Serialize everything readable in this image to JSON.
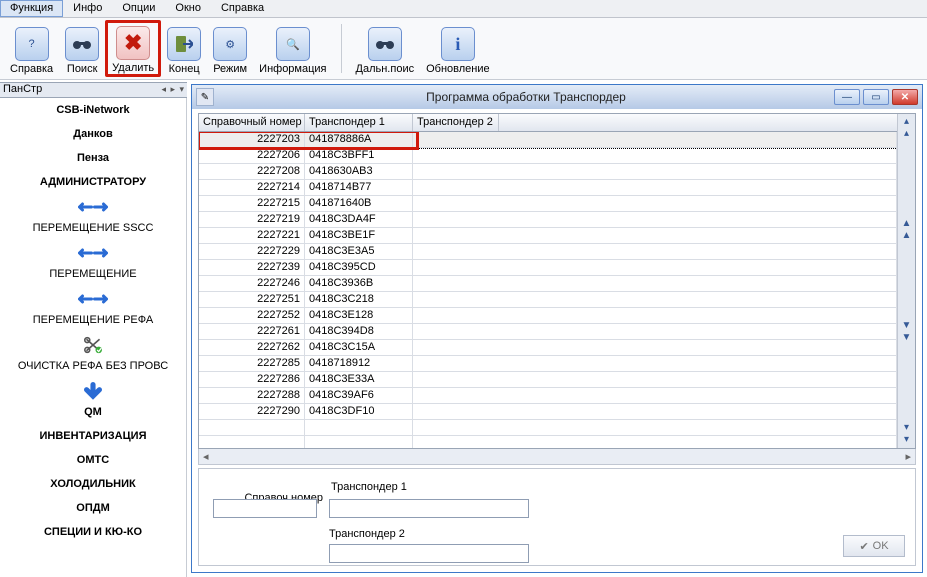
{
  "menu": {
    "items": [
      "Функция",
      "Инфо",
      "Опции",
      "Окно",
      "Справка"
    ],
    "active_index": 0
  },
  "toolbar": [
    {
      "label": "Справка",
      "icon": "?"
    },
    {
      "label": "Поиск",
      "icon": "bino"
    },
    {
      "label": "Удалить",
      "icon": "✖",
      "highlighted": true
    },
    {
      "label": "Конец",
      "icon": "exit"
    },
    {
      "label": "Режим",
      "icon": "⚙"
    },
    {
      "label": "Информация",
      "icon": "🔍"
    },
    {
      "sep": true
    },
    {
      "label": "Дальн.поис",
      "icon": "bino"
    },
    {
      "label": "Обновление",
      "icon": "i"
    }
  ],
  "sidehead": {
    "title": "ПанСтр"
  },
  "sidebar": [
    {
      "label": "CSB-iNetwork",
      "bold": true
    },
    {
      "label": "Данков",
      "bold": true
    },
    {
      "label": "Пенза",
      "bold": true
    },
    {
      "label": "АДМИНИСТРАТОРУ",
      "bold": true
    },
    {
      "icon": "hswap"
    },
    {
      "label": "ПЕРЕМЕЩЕНИЕ SSCC"
    },
    {
      "icon": "hswap"
    },
    {
      "label": "ПЕРЕМЕЩЕНИЕ"
    },
    {
      "icon": "hswap"
    },
    {
      "label": "ПЕРЕМЕЩЕНИЕ РЕФА"
    },
    {
      "icon": "scissor"
    },
    {
      "label": "ОЧИСТКА РЕФА БЕЗ ПРОВС"
    },
    {
      "icon": "down"
    },
    {
      "label": "QM",
      "bold": true
    },
    {
      "label": "ИНВЕНТАРИЗАЦИЯ",
      "bold": true
    },
    {
      "label": "ОМТС",
      "bold": true
    },
    {
      "label": "ХОЛОДИЛЬНИК",
      "bold": true
    },
    {
      "label": "ОПДМ",
      "bold": true
    },
    {
      "label": "СПЕЦИИ И КЮ-КО",
      "bold": true
    }
  ],
  "window": {
    "title": "Программа обработки Транспордер"
  },
  "grid": {
    "columns": [
      "Справочный номер",
      "Транспондер 1",
      "Транспондер 2"
    ],
    "rows": [
      {
        "c1": "2227203",
        "c2": "041878886A",
        "selected": true
      },
      {
        "c1": "2227206",
        "c2": "0418C3BFF1"
      },
      {
        "c1": "2227208",
        "c2": "0418630AB3"
      },
      {
        "c1": "2227214",
        "c2": "0418714B77"
      },
      {
        "c1": "2227215",
        "c2": "041871640B"
      },
      {
        "c1": "2227219",
        "c2": "0418C3DA4F"
      },
      {
        "c1": "2227221",
        "c2": "0418C3BE1F"
      },
      {
        "c1": "2227229",
        "c2": "0418C3E3A5"
      },
      {
        "c1": "2227239",
        "c2": "0418C395CD"
      },
      {
        "c1": "2227246",
        "c2": "0418C3936B"
      },
      {
        "c1": "2227251",
        "c2": "0418C3C218"
      },
      {
        "c1": "2227252",
        "c2": "0418C3E128"
      },
      {
        "c1": "2227261",
        "c2": "0418C394D8"
      },
      {
        "c1": "2227262",
        "c2": "0418C3C15A"
      },
      {
        "c1": "2227285",
        "c2": "0418718912"
      },
      {
        "c1": "2227286",
        "c2": "0418C3E33A"
      },
      {
        "c1": "2227288",
        "c2": "0418C39AF6"
      },
      {
        "c1": "2227290",
        "c2": "0418C3DF10"
      }
    ]
  },
  "form": {
    "ref_label": "Справоч.номер",
    "t1_label": "Транспондер 1",
    "t2_label": "Транспондер 2",
    "ok_label": "OK"
  }
}
